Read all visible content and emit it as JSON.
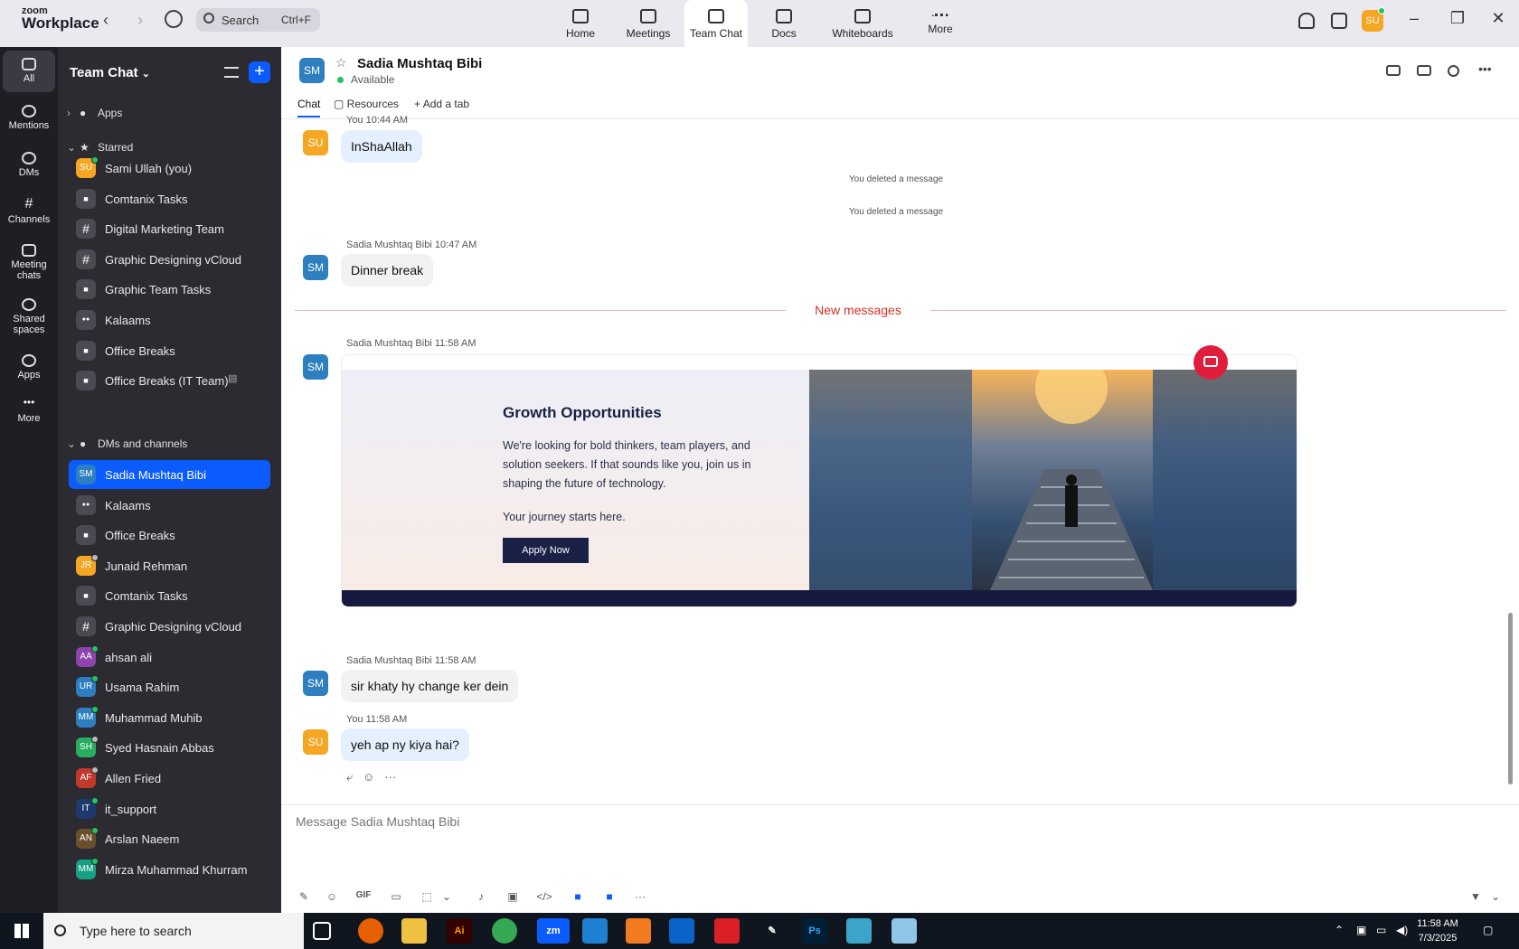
{
  "app": {
    "logo_line1": "zoom",
    "logo_line2": "Workplace",
    "search_label": "Search",
    "search_shortcut": "Ctrl+F",
    "user_initials": "SU"
  },
  "nav_tabs": [
    {
      "label": "Home",
      "icon": "home-icon"
    },
    {
      "label": "Meetings",
      "icon": "video-icon"
    },
    {
      "label": "Team Chat",
      "icon": "chat-icon"
    },
    {
      "label": "Docs",
      "icon": "doc-icon"
    },
    {
      "label": "Whiteboards",
      "icon": "whiteboard-icon"
    },
    {
      "label": "More",
      "icon": "more-icon"
    }
  ],
  "rail": [
    {
      "label": "All",
      "icon": "chat-bubble-icon"
    },
    {
      "label": "Mentions",
      "icon": "at-icon"
    },
    {
      "label": "DMs",
      "icon": "people-icon"
    },
    {
      "label": "Channels",
      "icon": "hash-icon"
    },
    {
      "label": "Meeting chats",
      "icon": "calendar-icon"
    },
    {
      "label": "Shared spaces",
      "icon": "share-icon"
    },
    {
      "label": "Apps",
      "icon": "apps-icon"
    },
    {
      "label": "More",
      "icon": "more-icon"
    }
  ],
  "sidebar": {
    "title": "Team Chat",
    "sections": {
      "apps": "Apps",
      "starred": "Starred",
      "dms": "DMs and channels"
    },
    "starred": [
      {
        "label": "Sami Ullah (you)",
        "initials": "SU",
        "kind": "person",
        "color": "#f5a623",
        "status": "#22c55e"
      },
      {
        "label": "Comtanix Tasks",
        "kind": "lock"
      },
      {
        "label": "Digital Marketing Team",
        "kind": "hash"
      },
      {
        "label": "Graphic Designing vCloud",
        "kind": "hash"
      },
      {
        "label": "Graphic Team Tasks",
        "kind": "lock"
      },
      {
        "label": "Kalaams",
        "kind": "group"
      },
      {
        "label": "Office Breaks",
        "kind": "lock"
      },
      {
        "label": "Office Breaks (IT Team)",
        "kind": "lock"
      }
    ],
    "dms": [
      {
        "label": "Sadia Mushtaq Bibi",
        "initials": "SM",
        "kind": "person",
        "color": "#2d7fc0",
        "selected": true
      },
      {
        "label": "Kalaams",
        "kind": "group"
      },
      {
        "label": "Office Breaks",
        "kind": "lock"
      },
      {
        "label": "Junaid Rehman",
        "initials": "JR",
        "kind": "person",
        "color": "#f5a623",
        "status": "#bbbbbb"
      },
      {
        "label": "Comtanix Tasks",
        "kind": "lock"
      },
      {
        "label": "Graphic Designing vCloud",
        "kind": "hash"
      },
      {
        "label": "ahsan ali",
        "initials": "AA",
        "kind": "person",
        "color": "#8e44ad",
        "status": "#22c55e"
      },
      {
        "label": "Usama Rahim",
        "initials": "UR",
        "kind": "person",
        "color": "#2d7fc0",
        "status": "#22c55e"
      },
      {
        "label": "Muhammad Muhib",
        "initials": "MM",
        "kind": "person",
        "color": "#2d7fc0",
        "status": "#22c55e"
      },
      {
        "label": "Syed Hasnain Abbas",
        "initials": "SH",
        "kind": "person",
        "color": "#27ae60",
        "status": "#bbbbbb"
      },
      {
        "label": "Allen Fried",
        "initials": "AF",
        "kind": "person",
        "color": "#c0392b",
        "status": "#bbbbbb"
      },
      {
        "label": "it_support",
        "initials": "IT",
        "kind": "person",
        "color": "#1d3a6e",
        "status": "#22c55e"
      },
      {
        "label": "Arslan Naeem",
        "initials": "AN",
        "kind": "person",
        "color": "#6b4f2a",
        "status": "#22c55e"
      },
      {
        "label": "Mirza Muhammad Khurram",
        "initials": "MM",
        "kind": "person",
        "color": "#16a085",
        "status": "#22c55e"
      }
    ]
  },
  "chat": {
    "contact_initials": "SM",
    "contact_name": "Sadia Mushtaq Bibi",
    "status": "Available",
    "tabs": [
      "Chat",
      "Resources",
      "Add a tab"
    ]
  },
  "messages": {
    "m1_meta": "You 10:44 AM",
    "m1_text": "InShaAllah",
    "deleted1": "You deleted a message",
    "deleted2": "You deleted a message",
    "m2_meta": "Sadia Mushtaq Bibi 10:47 AM",
    "m2_text": "Dinner break",
    "new_messages": "New messages",
    "m3_meta": "Sadia Mushtaq Bibi 11:58 AM",
    "card_title": "Growth Opportunities",
    "card_body": "We're looking for bold thinkers, team players, and solution seekers. If that sounds like you, join us in shaping the future of technology.",
    "card_sub": "Your journey starts here.",
    "card_button": "Apply Now",
    "m4_meta": "Sadia Mushtaq Bibi 11:58 AM",
    "m4_text": "sir khaty hy change ker dein",
    "m5_meta": "You 11:58 AM",
    "m5_text": "yeh ap ny kiya hai?",
    "self_initials": "SU",
    "other_initials": "SM"
  },
  "composer": {
    "placeholder": "Message Sadia Mushtaq Bibi",
    "gif_label": "GIF"
  },
  "taskbar": {
    "search_placeholder": "Type here to search",
    "time": "11:58 AM",
    "date": "7/3/2025",
    "apps": [
      {
        "label": "Ai",
        "bg": "#330000",
        "fg": "#ff9a00"
      },
      {
        "label": "zm",
        "bg": "#0b5cff",
        "fg": "#ffffff"
      },
      {
        "label": "Ps",
        "bg": "#001e36",
        "fg": "#31a8ff"
      }
    ]
  }
}
